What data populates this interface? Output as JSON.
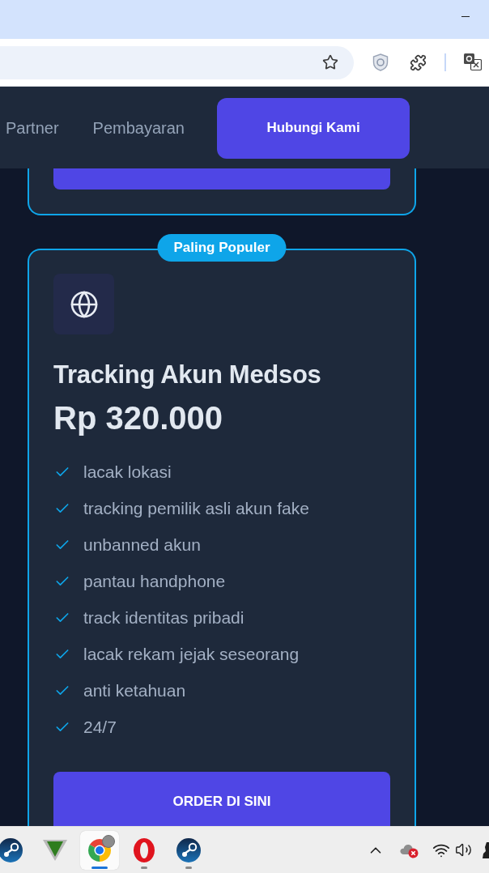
{
  "nav": {
    "links": [
      {
        "label": "Partner"
      },
      {
        "label": "Pembayaran"
      }
    ],
    "button": "Hubungi Kami"
  },
  "plan": {
    "badge": "Paling Populer",
    "title": "Tracking Akun Medsos",
    "price": "Rp 320.000",
    "features": [
      "lacak lokasi",
      "tracking pemilik asli akun fake",
      "unbanned akun",
      "pantau handphone",
      "track identitas pribadi",
      "lacak rekam jejak seseorang",
      "anti ketahuan",
      "24/7"
    ],
    "button": "ORDER DI SINI"
  },
  "taskbar": {
    "apps": [
      {
        "running": false,
        "selected": false
      },
      {
        "running": false,
        "selected": false
      },
      {
        "running": true,
        "selected": true
      },
      {
        "running": true,
        "selected": false
      },
      {
        "running": true,
        "selected": false
      }
    ]
  }
}
